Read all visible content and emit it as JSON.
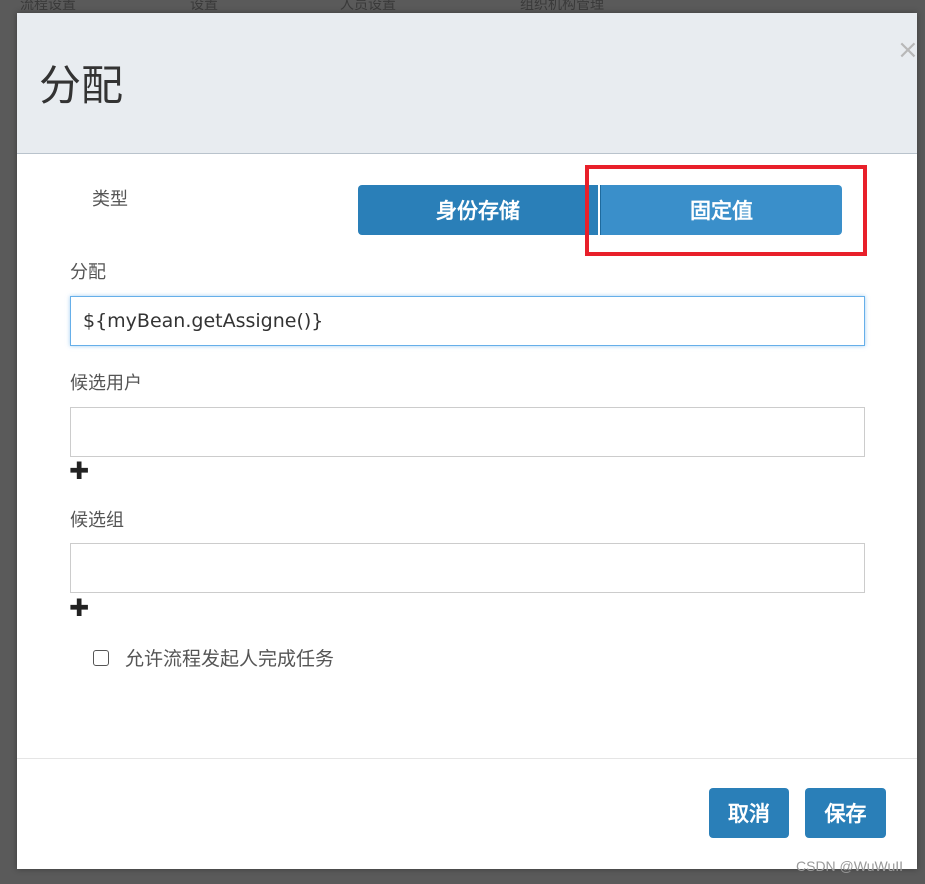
{
  "backdrop": {
    "fragments": [
      "流程设置",
      "设置",
      "人员设置",
      "组织机构管理"
    ]
  },
  "dialog": {
    "title": "分配",
    "close_icon": "close-icon",
    "type_label": "类型",
    "segments": {
      "identity_store": "身份存储",
      "fixed_value": "固定值"
    },
    "assignment_label": "分配",
    "assignment_value": "${myBean.getAssigne()}",
    "candidate_users_label": "候选用户",
    "candidate_users_value": "",
    "candidate_groups_label": "候选组",
    "candidate_groups_value": "",
    "add_icon": "plus-icon",
    "allow_initiator_label": "允许流程发起人完成任务",
    "allow_initiator_checked": false,
    "cancel_label": "取消",
    "save_label": "保存"
  },
  "annotation": {
    "highlight_color": "#e8202a"
  },
  "watermark": "CSDN @WuWuII",
  "colors": {
    "primary": "#2a7fb8",
    "header_bg": "#e8ecf0",
    "overlay": "#5a5a5a"
  }
}
